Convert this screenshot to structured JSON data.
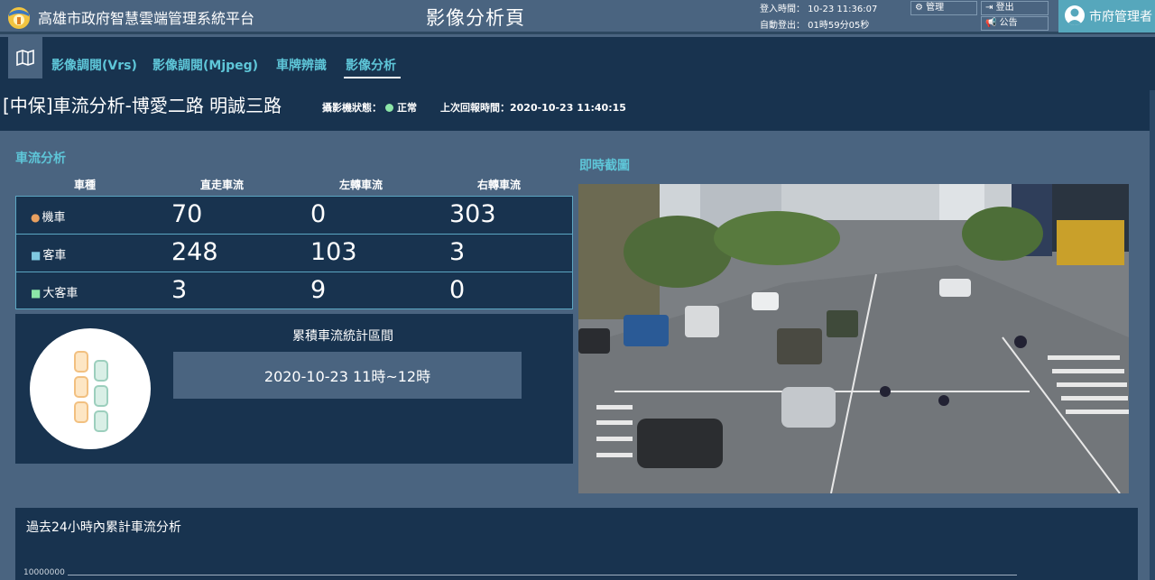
{
  "header": {
    "app_title": "高雄市政府智慧雲端管理系統平台",
    "page_title": "影像分析頁",
    "login_time": "登入時間： 10-23 11:36:07",
    "auto_logout": "自動登出： 01時59分05秒",
    "manage_label": "管理",
    "logout_label": "登出",
    "notice_label": "公告",
    "user_name": "市府管理者"
  },
  "nav": {
    "tabs": [
      {
        "label": "影像調閱(Vrs)"
      },
      {
        "label": "影像調閱(Mjpeg)"
      },
      {
        "label": "車牌辨識"
      },
      {
        "label": "影像分析"
      }
    ]
  },
  "camera": {
    "title": "[中保]車流分析-博愛二路 明誠三路",
    "status_label": "攝影機狀態：",
    "status_value": "正常",
    "last_report": "上次回報時間：2020-10-23 11:40:15",
    "status_color": "#8ce6a8"
  },
  "traffic": {
    "section_title": "車流分析",
    "columns": [
      "車種",
      "直走車流",
      "左轉車流",
      "右轉車流"
    ],
    "rows": [
      {
        "type": "機車",
        "icon": "motorcycle-icon",
        "straight": "70",
        "left": "0",
        "right": "303"
      },
      {
        "type": "客車",
        "icon": "car-icon",
        "straight": "248",
        "left": "103",
        "right": "3"
      },
      {
        "type": "大客車",
        "icon": "bus-icon",
        "straight": "3",
        "left": "9",
        "right": "0"
      }
    ],
    "stat_label": "累積車流統計區間",
    "stat_range": "2020-10-23 11時~12時"
  },
  "snapshot": {
    "title": "即時截圖"
  },
  "history": {
    "title": "過去24小時內累計車流分析",
    "axis_top": "10000000"
  },
  "colors": {
    "accent": "#5ec6d8",
    "panel": "#18334f",
    "background": "#4a6480"
  }
}
